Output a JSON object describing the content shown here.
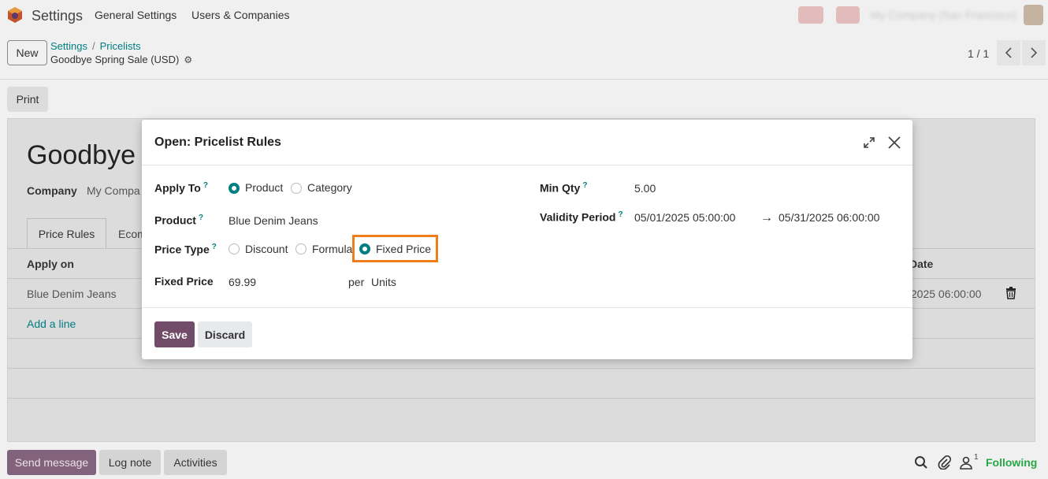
{
  "navbar": {
    "app_name": "Settings",
    "menu": [
      "General Settings",
      "Users & Companies"
    ],
    "company_switcher": "My Company (San Francisco)"
  },
  "control_panel": {
    "new_label": "New",
    "breadcrumb": [
      "Settings",
      "Pricelists"
    ],
    "record_title": "Goodbye Spring Sale (USD)",
    "pager": "1 / 1",
    "print_label": "Print"
  },
  "form": {
    "title": "Goodbye",
    "company_label": "Company",
    "company_value": "My Compa",
    "tabs": [
      "Price Rules",
      "Ecom"
    ],
    "columns": {
      "apply_on": "Apply on",
      "date": "Date"
    },
    "row": {
      "apply_on": "Blue Denim Jeans",
      "date_end": "/2025 06:00:00"
    },
    "add_line": "Add a line"
  },
  "chatter": {
    "send_message": "Send message",
    "log_note": "Log note",
    "activities": "Activities",
    "follower_count": "1",
    "following": "Following"
  },
  "modal": {
    "title": "Open: Pricelist Rules",
    "apply_to": {
      "label": "Apply To",
      "help": "?",
      "options": [
        "Product",
        "Category"
      ],
      "selected": "Product"
    },
    "product": {
      "label": "Product",
      "help": "?",
      "value": "Blue Denim Jeans"
    },
    "price_type": {
      "label": "Price Type",
      "help": "?",
      "options": [
        "Discount",
        "Formula",
        "Fixed Price"
      ],
      "selected": "Fixed Price"
    },
    "fixed_price": {
      "label": "Fixed Price",
      "value": "69.99",
      "per": "per",
      "uom": "Units"
    },
    "min_qty": {
      "label": "Min Qty",
      "help": "?",
      "value": "5.00"
    },
    "validity": {
      "label": "Validity Period",
      "help": "?",
      "start": "05/01/2025 05:00:00",
      "end": "05/31/2025 06:00:00"
    },
    "save": "Save",
    "discard": "Discard"
  },
  "colors": {
    "primary": "#714b67",
    "accent": "#017e84",
    "highlight": "#ef7d1a"
  }
}
